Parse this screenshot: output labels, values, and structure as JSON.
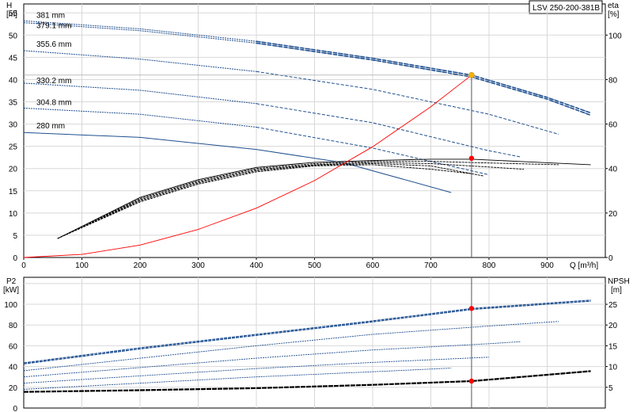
{
  "chart_data": [
    {
      "type": "line",
      "panel": "head-efficiency",
      "title_box": "LSV 250-200-381B",
      "left_axis": {
        "label_1": "H",
        "label_2": "[m]",
        "ylim": [
          0,
          57
        ],
        "ticks": [
          0,
          5,
          10,
          15,
          20,
          25,
          30,
          35,
          40,
          45,
          50,
          55
        ]
      },
      "right_axis": {
        "label_1": "eta",
        "label_2": "[%]",
        "ylim": [
          0,
          114
        ],
        "ticks": [
          0,
          20,
          40,
          60,
          80,
          100
        ]
      },
      "x_axis": {
        "label": "Q [m³/h]",
        "xlim": [
          0,
          1000
        ],
        "ticks": [
          0,
          100,
          200,
          300,
          400,
          500,
          600,
          700,
          800,
          900
        ]
      },
      "grid": true,
      "impeller_labels": [
        "381 mm",
        "379.1 mm",
        "355.6 mm",
        "330.2 mm",
        "304.8 mm",
        "280 mm"
      ],
      "head_series": [
        {
          "name": "381 mm",
          "color": "#1f4f8f",
          "points": [
            [
              0,
              53.2
            ],
            [
              200,
              51.4
            ],
            [
              400,
              48.6
            ],
            [
              600,
              44.8
            ],
            [
              770,
              41.0
            ],
            [
              900,
              36.0
            ],
            [
              975,
              32.5
            ]
          ]
        },
        {
          "name": "379.1 mm",
          "color": "#1f4f8f",
          "points": [
            [
              0,
              52.8
            ],
            [
              200,
              51.0
            ],
            [
              400,
              48.2
            ],
            [
              600,
              44.4
            ],
            [
              770,
              40.6
            ],
            [
              900,
              35.6
            ],
            [
              975,
              32.0
            ]
          ]
        },
        {
          "name": "355.6 mm",
          "color": "#1f4f8f",
          "points": [
            [
              0,
              46.5
            ],
            [
              200,
              44.6
            ],
            [
              400,
              41.8
            ],
            [
              600,
              37.8
            ],
            [
              800,
              32.2
            ],
            [
              920,
              27.7
            ]
          ]
        },
        {
          "name": "330.2 mm",
          "color": "#1f4f8f",
          "points": [
            [
              0,
              39.2
            ],
            [
              200,
              37.6
            ],
            [
              400,
              34.6
            ],
            [
              600,
              30.3
            ],
            [
              800,
              24.0
            ],
            [
              855,
              22.6
            ]
          ]
        },
        {
          "name": "304.8 mm",
          "color": "#1f4f8f",
          "points": [
            [
              0,
              33.6
            ],
            [
              200,
              32.2
            ],
            [
              400,
              29.3
            ],
            [
              600,
              24.6
            ],
            [
              800,
              18.6
            ]
          ]
        },
        {
          "name": "280 mm",
          "color": "#1f4f8f",
          "points": [
            [
              0,
              28.1
            ],
            [
              200,
              27.0
            ],
            [
              400,
              24.3
            ],
            [
              550,
              21.3
            ],
            [
              735,
              14.6
            ]
          ]
        }
      ],
      "eta_series": [
        {
          "name": "381 mm",
          "color": "#000000",
          "points": [
            [
              58,
              8.5
            ],
            [
              200,
              27
            ],
            [
              300,
              35
            ],
            [
              400,
              40.5
            ],
            [
              500,
              42.8
            ],
            [
              600,
              43.6
            ],
            [
              700,
              44.2
            ],
            [
              770,
              44.2
            ],
            [
              850,
              43.2
            ],
            [
              975,
              41.7
            ]
          ]
        },
        {
          "name": "355.6 mm",
          "color": "#000000",
          "points": [
            [
              58,
              8.5
            ],
            [
              200,
              26.5
            ],
            [
              300,
              34.5
            ],
            [
              400,
              40
            ],
            [
              500,
              42.2
            ],
            [
              600,
              43.2
            ],
            [
              700,
              43.2
            ],
            [
              800,
              42.5
            ],
            [
              920,
              41.7
            ]
          ]
        },
        {
          "name": "330.2 mm",
          "color": "#000000",
          "points": [
            [
              58,
              8.5
            ],
            [
              200,
              26
            ],
            [
              300,
              34
            ],
            [
              400,
              39.5
            ],
            [
              500,
              41.7
            ],
            [
              600,
              42.7
            ],
            [
              700,
              42.2
            ],
            [
              800,
              40.7
            ],
            [
              860,
              39.7
            ]
          ]
        },
        {
          "name": "304.8 mm",
          "color": "#000000",
          "points": [
            [
              58,
              8.5
            ],
            [
              200,
              25.5
            ],
            [
              300,
              33.5
            ],
            [
              400,
              39
            ],
            [
              500,
              41.5
            ],
            [
              600,
              42.2
            ],
            [
              700,
              41.2
            ],
            [
              790,
              36.7
            ]
          ]
        },
        {
          "name": "280 mm",
          "color": "#000000",
          "points": [
            [
              58,
              8.5
            ],
            [
              200,
              25
            ],
            [
              300,
              33
            ],
            [
              400,
              38.5
            ],
            [
              500,
              41.2
            ],
            [
              600,
              41.7
            ],
            [
              700,
              39.7
            ],
            [
              770,
              37.7
            ]
          ]
        }
      ],
      "system_curve": {
        "color": "#ff0000",
        "points": [
          [
            0,
            0
          ],
          [
            100,
            0.7
          ],
          [
            200,
            2.8
          ],
          [
            300,
            6.3
          ],
          [
            400,
            11.1
          ],
          [
            500,
            17.3
          ],
          [
            600,
            24.9
          ],
          [
            700,
            33.9
          ],
          [
            770,
            41.0
          ]
        ]
      },
      "duty_point": {
        "q": 770,
        "h": 41.0,
        "color": "#f5b300"
      },
      "eta_point": {
        "q": 770,
        "eta": 44.6,
        "color": "#ff0000"
      }
    },
    {
      "type": "line",
      "panel": "power-npsh",
      "left_axis": {
        "label_1": "P2",
        "label_2": "[kW]",
        "ylim": [
          0,
          126
        ],
        "ticks": [
          0,
          20,
          40,
          60,
          80,
          100,
          120
        ]
      },
      "right_axis": {
        "label_1": "NPSH",
        "label_2": "[m]",
        "ylim": [
          0,
          31.5
        ],
        "ticks": [
          5,
          10,
          15,
          20,
          25
        ]
      },
      "grid": true,
      "power_series": [
        {
          "name": "381 mm",
          "color": "#1f4f8f",
          "points": [
            [
              0,
              43.5
            ],
            [
              200,
              58
            ],
            [
              400,
              71
            ],
            [
              600,
              84
            ],
            [
              770,
              96
            ],
            [
              975,
              104
            ]
          ]
        },
        {
          "name": "379.1 mm",
          "color": "#1f4f8f",
          "points": [
            [
              0,
              42.5
            ],
            [
              200,
              57
            ],
            [
              400,
              70
            ],
            [
              600,
              83
            ],
            [
              770,
              95
            ],
            [
              975,
              103
            ]
          ]
        },
        {
          "name": "355.6 mm",
          "color": "#1f4f8f",
          "points": [
            [
              0,
              36
            ],
            [
              200,
              48
            ],
            [
              400,
              60
            ],
            [
              600,
              71
            ],
            [
              800,
              79
            ],
            [
              920,
              83.5
            ]
          ]
        },
        {
          "name": "330.2 mm",
          "color": "#1f4f8f",
          "points": [
            [
              0,
              30
            ],
            [
              200,
              39
            ],
            [
              400,
              48
            ],
            [
              600,
              56
            ],
            [
              800,
              62
            ],
            [
              855,
              64
            ]
          ]
        },
        {
          "name": "304.8 mm",
          "color": "#1f4f8f",
          "points": [
            [
              0,
              24
            ],
            [
              200,
              31
            ],
            [
              400,
              38
            ],
            [
              600,
              44
            ],
            [
              800,
              49
            ]
          ]
        },
        {
          "name": "280 mm",
          "color": "#1f4f8f",
          "points": [
            [
              0,
              18
            ],
            [
              200,
              24
            ],
            [
              400,
              30
            ],
            [
              600,
              35
            ],
            [
              735,
              38.5
            ]
          ]
        }
      ],
      "npsh_series": [
        {
          "name": "NPSH",
          "color": "#000000",
          "points": [
            [
              0,
              3.9
            ],
            [
              200,
              4.3
            ],
            [
              400,
              4.8
            ],
            [
              600,
              5.6
            ],
            [
              770,
              6.5
            ],
            [
              975,
              8.9
            ]
          ]
        }
      ],
      "power_point": {
        "q": 770,
        "p2": 96,
        "color": "#ff0000"
      },
      "npsh_point": {
        "q": 770,
        "npsh": 6.5,
        "color": "#ff0000"
      }
    }
  ]
}
